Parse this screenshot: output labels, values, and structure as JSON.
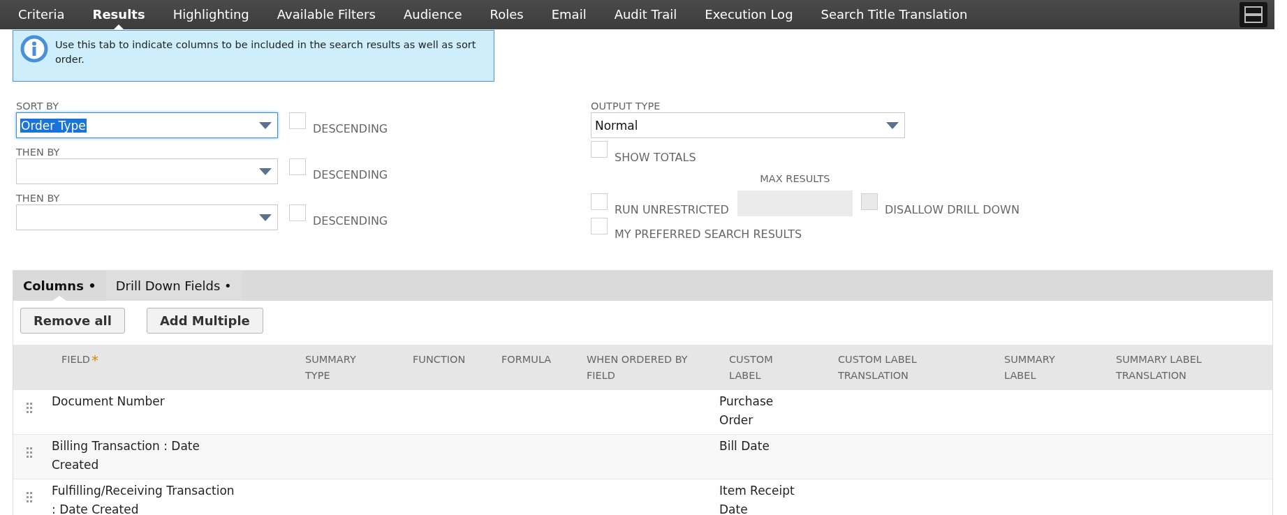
{
  "tabs": [
    {
      "label": "Criteria",
      "selected": false
    },
    {
      "label": "Results",
      "selected": true
    },
    {
      "label": "Highlighting",
      "selected": false
    },
    {
      "label": "Available Filters",
      "selected": false
    },
    {
      "label": "Audience",
      "selected": false
    },
    {
      "label": "Roles",
      "selected": false
    },
    {
      "label": "Email",
      "selected": false
    },
    {
      "label": "Audit Trail",
      "selected": false
    },
    {
      "label": "Execution Log",
      "selected": false
    },
    {
      "label": "Search Title Translation",
      "selected": false
    }
  ],
  "info_message": "Use this tab to indicate columns to be included in the search results as well as sort order.",
  "sort_fields": [
    {
      "label": "SORT BY",
      "value": "Order Type",
      "focused": true,
      "descending_label": "DESCENDING",
      "descending_checked": false
    },
    {
      "label": "THEN BY",
      "focused": false,
      "descending_label": "DESCENDING",
      "descending_checked": false
    },
    {
      "label": "THEN BY",
      "focused": false,
      "descending_label": "DESCENDING",
      "descending_checked": false
    }
  ],
  "output_type": {
    "label": "OUTPUT TYPE",
    "value": "Normal"
  },
  "show_totals": {
    "label": "SHOW TOTALS",
    "checked": false
  },
  "max_results": {
    "label": "MAX RESULTS",
    "disabled": true
  },
  "run_unrestricted": {
    "label": "RUN UNRESTRICTED",
    "checked": false
  },
  "disallow_drill_down": {
    "label": "DISALLOW DRILL DOWN",
    "checked": false,
    "disabled": true
  },
  "my_preferred": {
    "label": "MY PREFERRED SEARCH RESULTS",
    "checked": false
  },
  "subtabs": [
    {
      "label": "Columns",
      "marker": "•",
      "selected": true
    },
    {
      "label": "Drill Down Fields",
      "marker": "•",
      "selected": false
    }
  ],
  "buttons": [
    "Remove all",
    "Add Multiple"
  ],
  "table": {
    "columns": [
      {
        "label": "FIELD",
        "required": true
      },
      {
        "label": "SUMMARY TYPE",
        "required": false
      },
      {
        "label": "FUNCTION",
        "required": false
      },
      {
        "label": "FORMULA",
        "required": false
      },
      {
        "label": "WHEN ORDERED BY FIELD",
        "required": false
      },
      {
        "label": "CUSTOM LABEL",
        "required": false
      },
      {
        "label": "CUSTOM LABEL TRANSLATION",
        "required": false
      },
      {
        "label": "SUMMARY LABEL",
        "required": false
      },
      {
        "label": "SUMMARY LABEL TRANSLATION",
        "required": false
      }
    ],
    "required_mark": "*",
    "rows": [
      {
        "field": "Document Number",
        "custom_label": "Purchase Order"
      },
      {
        "field": "Billing Transaction : Date Created",
        "custom_label": "Bill Date"
      },
      {
        "field": "Fulfilling/Receiving Transaction : Date Created",
        "custom_label": "Item Receipt Date"
      }
    ]
  }
}
